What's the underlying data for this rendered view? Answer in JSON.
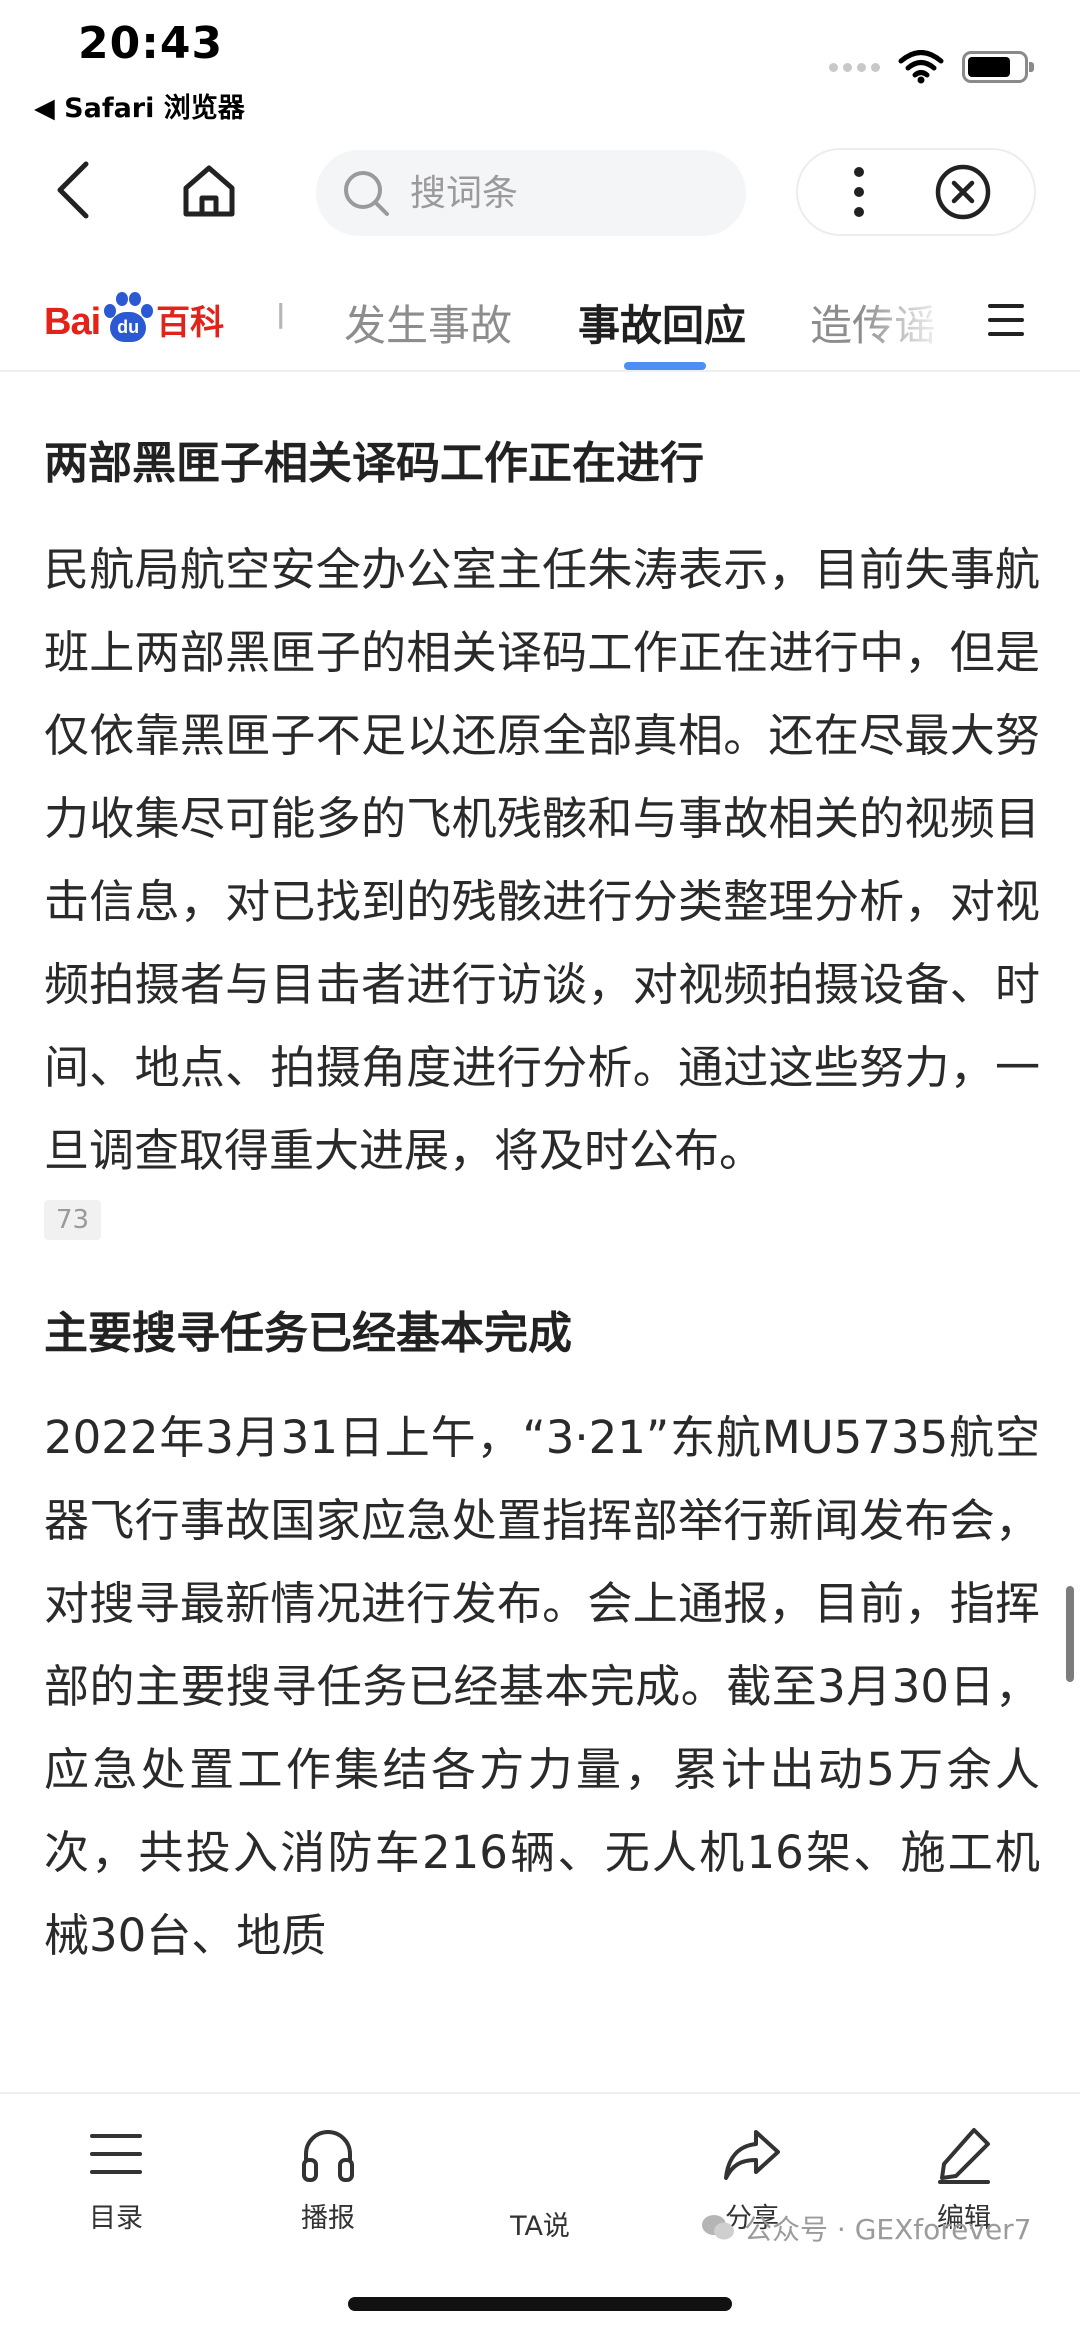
{
  "status_bar": {
    "time": "20:43",
    "back_app": "◀ Safari 浏览器"
  },
  "nav": {
    "search_placeholder": "搜词条"
  },
  "logo": {
    "brand_left": "Bai",
    "brand_paw": "du",
    "brand_right": "百科"
  },
  "tabs": {
    "partial_left": "l",
    "items": [
      {
        "label": "发生事故",
        "active": false
      },
      {
        "label": "事故回应",
        "active": true
      },
      {
        "label": "造传谣",
        "active": false
      }
    ]
  },
  "content": {
    "sections": [
      {
        "title": "两部黑匣子相关译码工作正在进行",
        "paragraph": "民航局航空安全办公室主任朱涛表示，目前失事航班上两部黑匣子的相关译码工作正在进行中，但是仅依靠黑匣子不足以还原全部真相。还在尽最大努力收集尽可能多的飞机残骸和与事故相关的视频目击信息，对已找到的残骸进行分类整理分析，对视频拍摄者与目击者进行访谈，对视频拍摄设备、时间、地点、拍摄角度进行分析。通过这些努力，一旦调查取得重大进展，将及时公布。",
        "ref": "73"
      },
      {
        "title": "主要搜寻任务已经基本完成",
        "paragraph": "2022年3月31日上午，“3·21”东航MU5735航空器飞行事故国家应急处置指挥部举行新闻发布会，对搜寻最新情况进行发布。会上通报，目前，指挥部的主要搜寻任务已经基本完成。截至3月30日，应急处置工作集结各方力量，累计出动5万余人次，共投入消防车216辆、无人机16架、施工机械30台、地质"
      }
    ]
  },
  "bottom_bar": {
    "catalog": "目录",
    "broadcast": "播报",
    "ta_say": "TA说",
    "share": "分享",
    "edit": "编辑"
  },
  "watermark": {
    "text": "公众号 · GEXforever7"
  },
  "colors": {
    "accent_blue": "#4e8ff5",
    "brand_red": "#e1231a",
    "brand_blue": "#2b59d4"
  }
}
